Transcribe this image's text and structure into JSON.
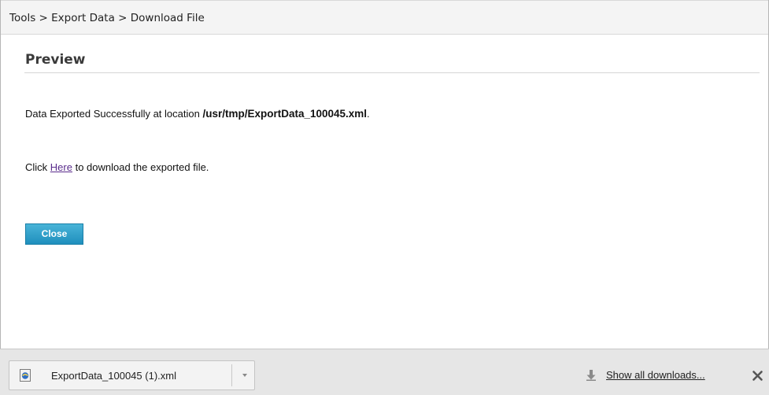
{
  "breadcrumb": {
    "text": "Tools > Export Data > Download File"
  },
  "preview": {
    "title": "Preview",
    "message_prefix": "Data Exported Successfully at location ",
    "message_path": "/usr/tmp/ExportData_100045.xml",
    "message_suffix": ".",
    "click_prefix": "Click ",
    "click_link": "Here",
    "click_suffix": " to download the exported file.",
    "close_label": "Close"
  },
  "downloads": {
    "file_name": "ExportData_100045 (1).xml",
    "show_all_label": "Show all downloads...",
    "file_icon": "xml-file-icon",
    "dropdown_icon": "chevron-down-icon",
    "show_all_icon": "download-arrow-icon",
    "close_icon": "close-icon"
  },
  "colors": {
    "button_bg": "#2a9bc8",
    "link": "#5a2c8c",
    "breadcrumb_bg": "#f4f4f4",
    "shelf_bg": "#e6e6e6"
  }
}
